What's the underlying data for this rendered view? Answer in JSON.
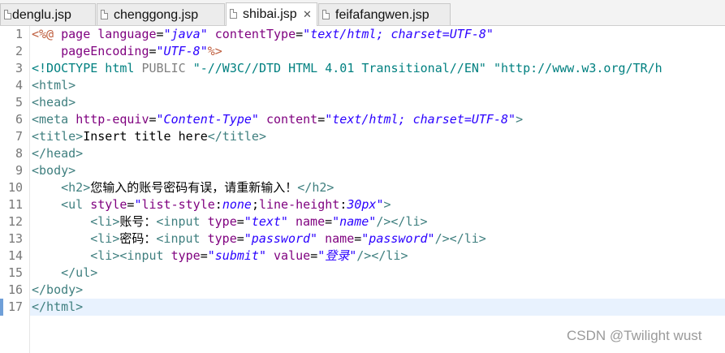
{
  "tabs": [
    {
      "label": "denglu.jsp"
    },
    {
      "label": "chenggong.jsp"
    },
    {
      "label": "shibai.jsp",
      "close": "✕"
    },
    {
      "label": "feifafangwen.jsp"
    }
  ],
  "line_numbers": [
    "1",
    "2",
    "3",
    "4",
    "5",
    "6",
    "7",
    "8",
    "9",
    "10",
    "11",
    "12",
    "13",
    "14",
    "15",
    "16",
    "17"
  ],
  "code": {
    "l1": [
      "<%@",
      " page ",
      "language",
      "=",
      "\"java\"",
      " ",
      "contentType",
      "=",
      "\"text/html; charset=UTF-8\""
    ],
    "l2": [
      "    ",
      "pageEncoding",
      "=",
      "\"UTF-8\"",
      "%>"
    ],
    "l3": [
      "<!DOCTYPE",
      " html ",
      "PUBLIC",
      " ",
      "\"-//W3C//DTD HTML 4.01 Transitional//EN\"",
      " ",
      "\"http://www.w3.org/TR/h"
    ],
    "l4": [
      "<html>"
    ],
    "l5": [
      "<head>"
    ],
    "l6": [
      "<meta",
      " ",
      "http-equiv",
      "=",
      "\"Content-Type\"",
      " ",
      "content",
      "=",
      "\"text/html; charset=UTF-8\"",
      ">"
    ],
    "l7": [
      "<title>",
      "Insert title here",
      "</title>"
    ],
    "l8": [
      "</head>"
    ],
    "l9": [
      "<body>"
    ],
    "l10": [
      "    ",
      "<h2>",
      "您输入的账号密码有误，请重新输入！",
      "</h2>"
    ],
    "l11": [
      "    ",
      "<ul",
      " ",
      "style",
      "=",
      "\"",
      "list-style",
      ":",
      "none",
      ";",
      "line-height",
      ":",
      "30px",
      "\"",
      ">"
    ],
    "l12": [
      "        ",
      "<li>",
      "账号：",
      "<input",
      " ",
      "type",
      "=",
      "\"text\"",
      " ",
      "name",
      "=",
      "\"name\"",
      "/>",
      "</li>"
    ],
    "l13": [
      "        ",
      "<li>",
      "密码：",
      "<input",
      " ",
      "type",
      "=",
      "\"password\"",
      " ",
      "name",
      "=",
      "\"password\"",
      "/>",
      "</li>"
    ],
    "l14": [
      "        ",
      "<li>",
      "<input",
      " ",
      "type",
      "=",
      "\"submit\"",
      " ",
      "value",
      "=",
      "\"登录\"",
      "/>",
      "</li>"
    ],
    "l15": [
      "    ",
      "</ul>"
    ],
    "l16": [
      "</body>"
    ],
    "l17": [
      "</html>"
    ]
  },
  "watermark": "CSDN @Twilight wust",
  "colors": {
    "tag": "#3f7f7f",
    "attribute": "#7f007f",
    "string": "#2a00ff",
    "doctype": "#008080",
    "jsp_delimiter": "#bf5f3f",
    "current_line": "#e8f2fe"
  }
}
